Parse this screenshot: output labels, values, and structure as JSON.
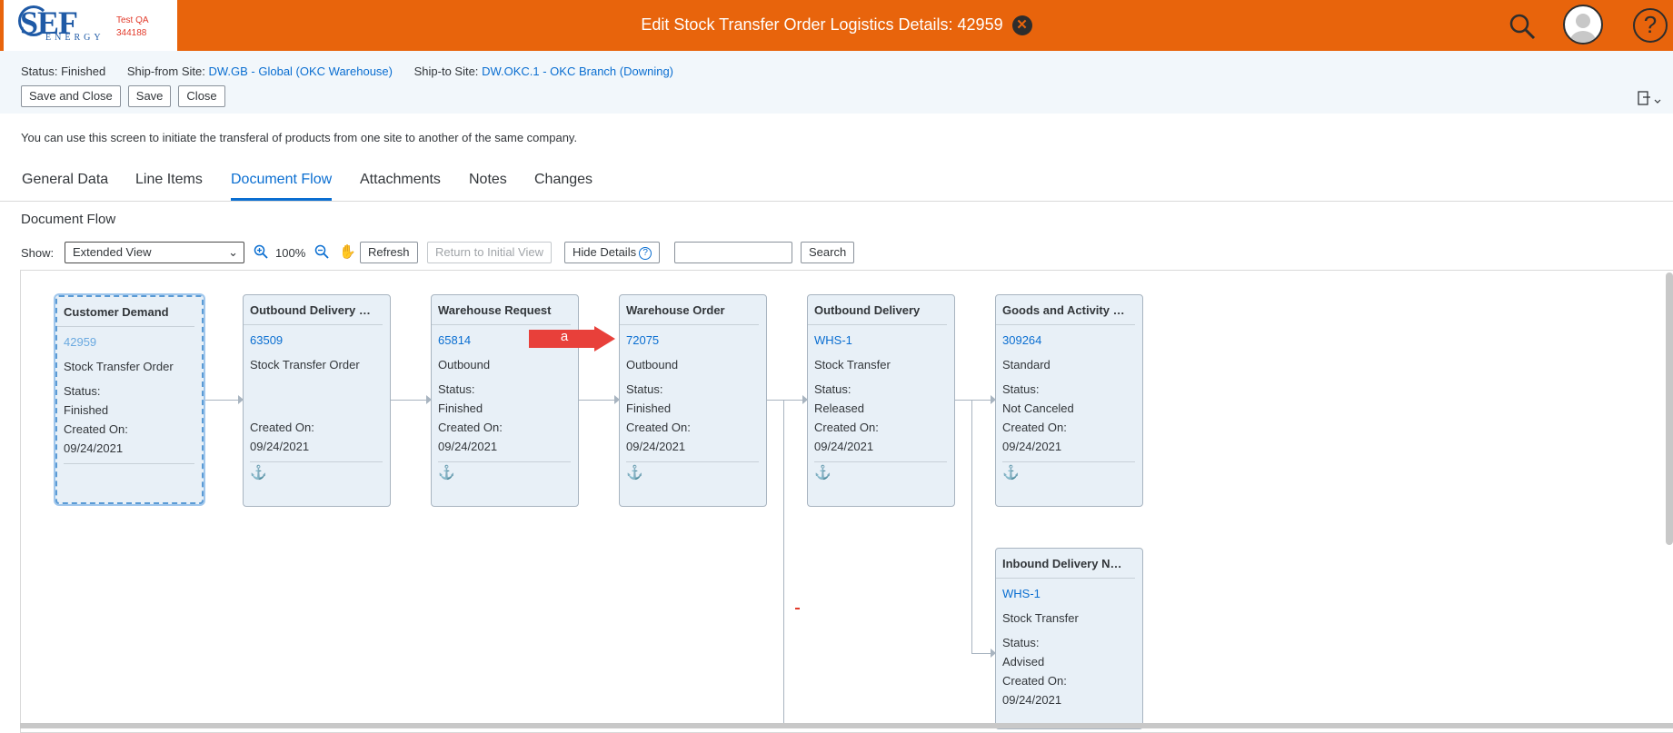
{
  "shell": {
    "logo_text": "SEF",
    "logo_subtext": "ENERGY",
    "system_label": "Test QA",
    "system_id": "344188",
    "title": "Edit Stock Transfer Order Logistics Details: 42959",
    "close_glyph": "✕",
    "icons": [
      "search-icon",
      "user-avatar-icon",
      "help-icon"
    ]
  },
  "header": {
    "status_label": "Status:",
    "status_value": "Finished",
    "ship_from_label": "Ship-from Site:",
    "ship_from_value": "DW.GB - Global (OKC Warehouse)",
    "ship_to_label": "Ship-to Site:",
    "ship_to_value": "DW.OKC.1 - OKC Branch (Downing)",
    "buttons": {
      "save_close": "Save and Close",
      "save": "Save",
      "close": "Close"
    }
  },
  "info_text": "You can use this screen to initiate the transferal of products from one site to another of the same company.",
  "tabs": [
    {
      "label": "General Data"
    },
    {
      "label": "Line Items"
    },
    {
      "label": "Document Flow",
      "active": true
    },
    {
      "label": "Attachments"
    },
    {
      "label": "Notes"
    },
    {
      "label": "Changes"
    }
  ],
  "section_title": "Document Flow",
  "toolbar": {
    "show_label": "Show:",
    "show_value": "Extended View",
    "zoom": "100%",
    "refresh": "Refresh",
    "return_initial": "Return to Initial View",
    "hide_details": "Hide Details",
    "search_value": "",
    "search": "Search"
  },
  "nodes": [
    {
      "title": "Customer Demand",
      "id": "42959",
      "type": "Stock Transfer Order",
      "status_label": "Status:",
      "status": "Finished",
      "created_label": "Created On:",
      "created": "09/24/2021",
      "selected": true
    },
    {
      "title": "Outbound Delivery R...",
      "id": "63509",
      "type": "Stock Transfer Order",
      "status_label": "",
      "status": "",
      "created_label": "Created On:",
      "created": "09/24/2021"
    },
    {
      "title": "Warehouse Request",
      "id": "65814",
      "type": "Outbound",
      "status_label": "Status:",
      "status": "Finished",
      "created_label": "Created On:",
      "created": "09/24/2021"
    },
    {
      "title": "Warehouse Order",
      "id": "72075",
      "type": "Outbound",
      "status_label": "Status:",
      "status": "Finished",
      "created_label": "Created On:",
      "created": "09/24/2021"
    },
    {
      "title": "Outbound Delivery",
      "id": "WHS-1",
      "type": "Stock Transfer",
      "status_label": "Status:",
      "status": "Released",
      "created_label": "Created On:",
      "created": "09/24/2021"
    },
    {
      "title": "Goods and Activity C...",
      "id": "309264",
      "type": "Standard",
      "status_label": "Status:",
      "status": "Not Canceled",
      "created_label": "Created On:",
      "created": "09/24/2021"
    },
    {
      "title": "Inbound Delivery Noti...",
      "id": "WHS-1",
      "type": "Stock Transfer",
      "status_label": "Status:",
      "status": "Advised",
      "created_label": "Created On:",
      "created": "09/24/2021"
    }
  ],
  "annotation": {
    "label": "a",
    "color": "#e8403a"
  }
}
